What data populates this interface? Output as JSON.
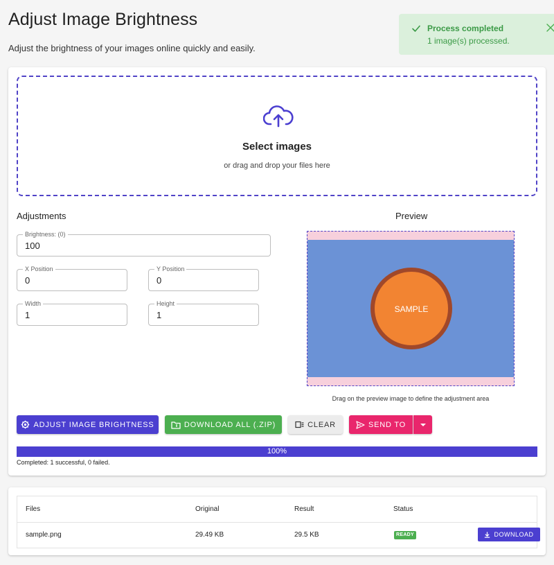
{
  "header": {
    "title": "Adjust Image Brightness",
    "subtitle": "Adjust the brightness of your images online quickly and easily."
  },
  "toast": {
    "title": "Process completed",
    "message": "1 image(s) processed.",
    "icon": "check-icon",
    "color": "#3b9a46"
  },
  "dropzone": {
    "title": "Select images",
    "hint": "or drag and drop your files here",
    "icon": "cloud-upload-icon"
  },
  "adjustments": {
    "heading": "Adjustments",
    "brightness": {
      "label": "Brightness: (0)",
      "value": "100"
    },
    "x_position": {
      "label": "X Position",
      "value": "0"
    },
    "y_position": {
      "label": "Y Position",
      "value": "0"
    },
    "width": {
      "label": "Width",
      "value": "1"
    },
    "height": {
      "label": "Height",
      "value": "1"
    }
  },
  "preview": {
    "heading": "Preview",
    "sample_text": "SAMPLE",
    "hint": "Drag on the preview image to define the adjustment area"
  },
  "actions": {
    "adjust": "Adjust Image Brightness",
    "download_all": "Download All (.ZIP)",
    "clear": "Clear",
    "send_to": "Send To"
  },
  "progress": {
    "percent_label": "100%",
    "percent": 100,
    "status": "Completed: 1 successful, 0 failed."
  },
  "files_table": {
    "columns": [
      "Files",
      "Original",
      "Result",
      "Status"
    ],
    "rows": [
      {
        "file": "sample.png",
        "original": "29.49 KB",
        "result": "29.5 KB",
        "status": "READY",
        "action": "Download"
      }
    ]
  },
  "colors": {
    "primary": "#4b3fd0",
    "success": "#4caf50",
    "send": "#e9266c",
    "toast_bg": "#dbf0dc"
  }
}
